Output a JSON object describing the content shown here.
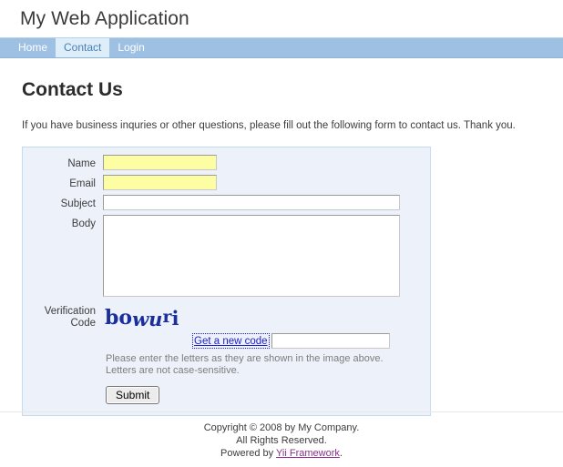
{
  "header": {
    "site_title": "My Web Application"
  },
  "nav": {
    "items": [
      {
        "label": "Home",
        "active": false
      },
      {
        "label": "Contact",
        "active": true
      },
      {
        "label": "Login",
        "active": false
      }
    ]
  },
  "main": {
    "page_title": "Contact Us",
    "intro_text": "If you have business inquries or other questions, please fill out the following form to contact us. Thank you.",
    "form": {
      "fields": {
        "name": {
          "label": "Name",
          "value": "",
          "placeholder": ""
        },
        "email": {
          "label": "Email",
          "value": "",
          "placeholder": ""
        },
        "subject": {
          "label": "Subject",
          "value": "",
          "placeholder": ""
        },
        "body": {
          "label": "Body",
          "value": "",
          "placeholder": ""
        },
        "verification": {
          "label_line1": "Verification",
          "label_line2": "Code",
          "value": "",
          "placeholder": ""
        }
      },
      "captcha": {
        "text": "bowuri",
        "chars": [
          "b",
          "o",
          "w",
          "u",
          "r",
          "i"
        ],
        "color": "#1a2e9e",
        "refresh_link_label": "Get a new code"
      },
      "hint_line1": "Please enter the letters as they are shown in the image above.",
      "hint_line2": "Letters are not case-sensitive.",
      "submit_label": "Submit"
    }
  },
  "footer": {
    "copyright": "Copyright © 2008 by My Company.",
    "rights": "All Rights Reserved.",
    "powered_prefix": "Powered by ",
    "powered_link": "Yii Framework",
    "powered_suffix": "."
  },
  "colors": {
    "nav_background": "#9dc0e3",
    "nav_active_background": "#ddeef8",
    "nav_active_text": "#4a80b8",
    "form_background": "#edf2fa",
    "form_border": "#c3dcf0",
    "autofill_yellow": "#fdfda4",
    "link_blue": "#1c1ccc",
    "footer_link_purple": "#8a2f8a"
  }
}
